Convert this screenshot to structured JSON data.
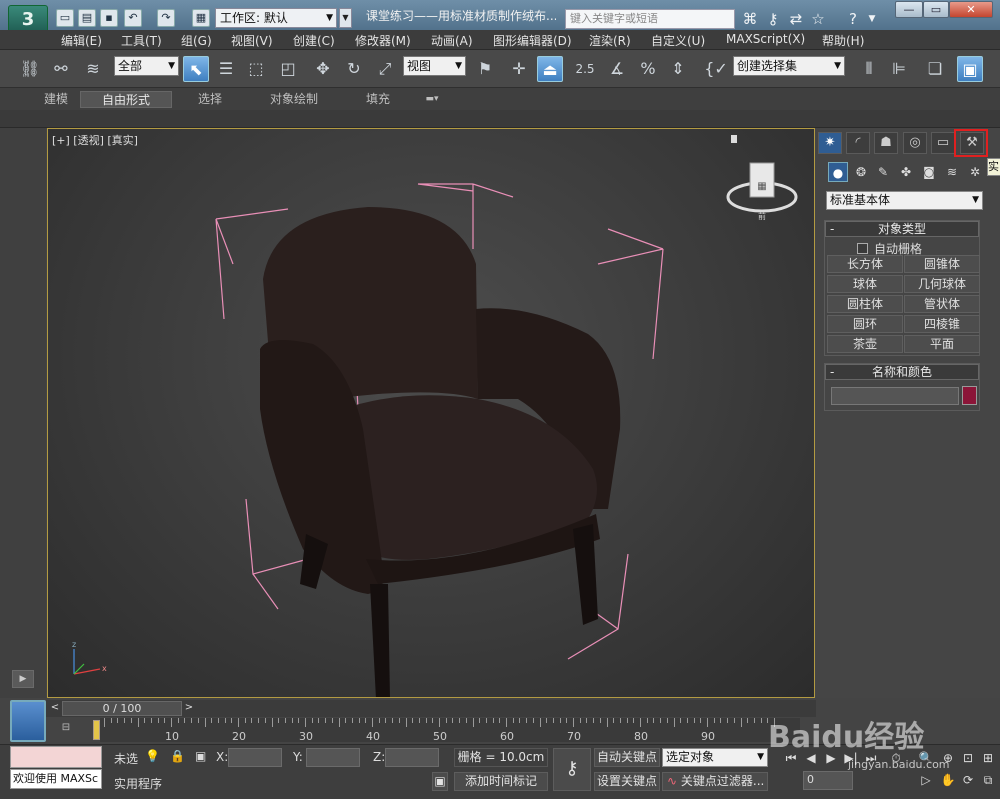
{
  "titlebar": {
    "logo": "3",
    "workspace_label": "工作区: 默认",
    "document_title": "课堂练习——用标准材质制作绒布...",
    "search_placeholder": "键入关键字或短语"
  },
  "menu": [
    "编辑(E)",
    "工具(T)",
    "组(G)",
    "视图(V)",
    "创建(C)",
    "修改器(M)",
    "动画(A)",
    "图形编辑器(D)",
    "渲染(R)",
    "自定义(U)",
    "MAXScript(X)",
    "帮助(H)"
  ],
  "toolbar": {
    "selection_filter": "全部",
    "ref_coord": "视图",
    "snap_value": "2.5",
    "named_selection": "创建选择集"
  },
  "ribbon": {
    "tabs": [
      "建模",
      "自由形式",
      "选择",
      "对象绘制",
      "填充"
    ],
    "selected_tab": "自由形式"
  },
  "viewport": {
    "label": "[+] [透视] [真实]",
    "viewcube_label": "前"
  },
  "command_panel": {
    "tooltip_text": "实",
    "primitive_type": "标准基本体",
    "object_type": {
      "title": "对象类型",
      "autogrid_label": "自动栅格",
      "buttons": [
        "长方体",
        "圆锥体",
        "球体",
        "几何球体",
        "圆柱体",
        "管状体",
        "圆环",
        "四棱锥",
        "茶壶",
        "平面"
      ]
    },
    "name_color": {
      "title": "名称和颜色",
      "swatch_color": "#8b1538"
    }
  },
  "timeline": {
    "frame_display": "0 / 100",
    "ticks": [
      "10",
      "20",
      "30",
      "40",
      "50",
      "60",
      "70",
      "80",
      "90"
    ]
  },
  "status": {
    "maxscript_text": "欢迎使用 MAXSc",
    "selection_text": "未选",
    "util_text": "实用程序",
    "x_label": "X:",
    "y_label": "Y:",
    "z_label": "Z:",
    "grid_text": "栅格 = 10.0cm",
    "add_time_tag": "添加时间标记",
    "auto_key": "自动关键点",
    "set_key": "设置关键点",
    "selected_object": "选定对象",
    "key_filters": "关键点过滤器...",
    "frame_value": "0"
  },
  "watermark": {
    "text": "Baidu经验",
    "url": "jingyan.baidu.com"
  }
}
